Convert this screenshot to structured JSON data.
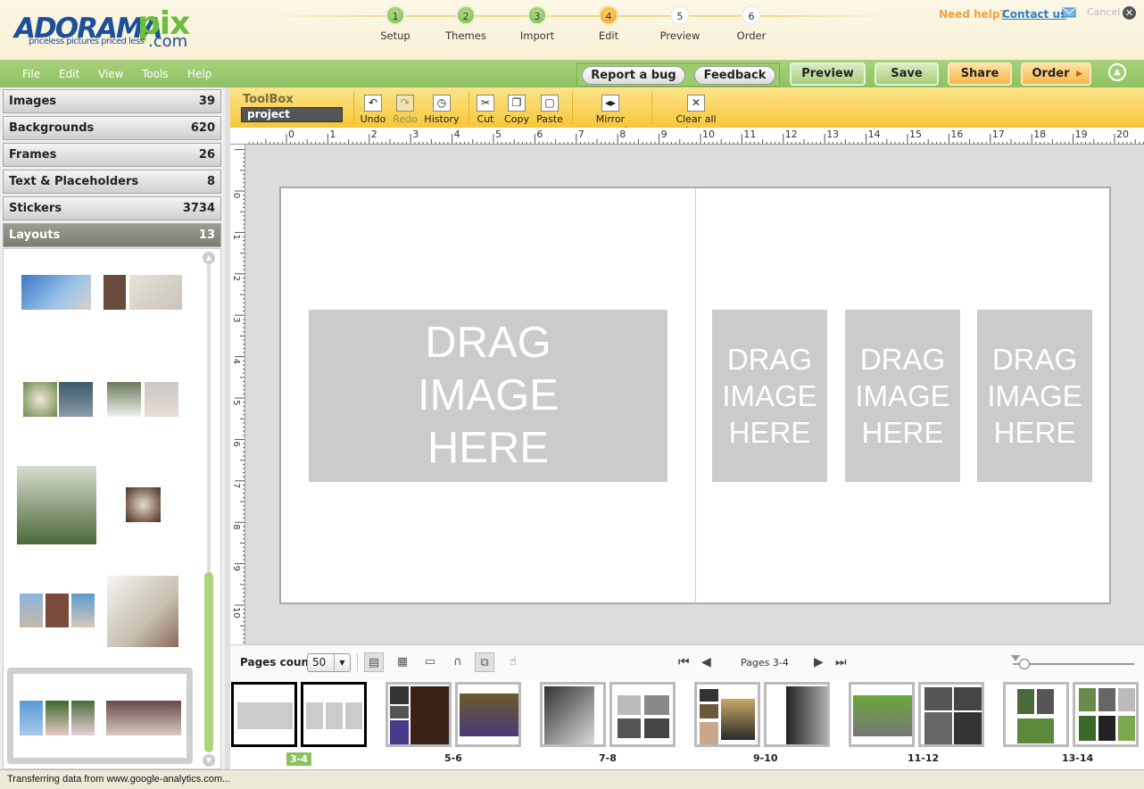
{
  "brand": {
    "name_a": "ADORAMA",
    "name_b": "pix",
    "dotcom": ".com",
    "tagline": "priceless pictures priced less"
  },
  "steps": [
    {
      "num": "1",
      "label": "Setup",
      "state": "done"
    },
    {
      "num": "2",
      "label": "Themes",
      "state": "done"
    },
    {
      "num": "3",
      "label": "Import",
      "state": "done"
    },
    {
      "num": "4",
      "label": "Edit",
      "state": "current"
    },
    {
      "num": "5",
      "label": "Preview",
      "state": "todo"
    },
    {
      "num": "6",
      "label": "Order",
      "state": "todo"
    }
  ],
  "help": {
    "text": "Need help?",
    "contact": "Contact us",
    "cancel": "Cancel"
  },
  "menu": [
    "File",
    "Edit",
    "View",
    "Tools",
    "Help"
  ],
  "actions": {
    "report_bug": "Report a bug",
    "feedback": "Feedback",
    "preview": "Preview",
    "save": "Save",
    "share": "Share",
    "order": "Order"
  },
  "sidebar": {
    "categories": [
      {
        "label": "Images",
        "count": "39"
      },
      {
        "label": "Backgrounds",
        "count": "620"
      },
      {
        "label": "Frames",
        "count": "26"
      },
      {
        "label": "Text & Placeholders",
        "count": "8"
      },
      {
        "label": "Stickers",
        "count": "3734"
      },
      {
        "label": "Layouts",
        "count": "13",
        "active": true
      }
    ]
  },
  "toolbox": {
    "title": "ToolBox",
    "project": "project",
    "tools": [
      {
        "label": "Undo",
        "icon": "undo-icon",
        "glyph": "↶",
        "enabled": true
      },
      {
        "label": "Redo",
        "icon": "redo-icon",
        "glyph": "↷",
        "enabled": false
      },
      {
        "label": "History",
        "icon": "history-icon",
        "glyph": "◷",
        "enabled": true
      },
      {
        "label": "Cut",
        "icon": "cut-icon",
        "glyph": "✂",
        "enabled": true
      },
      {
        "label": "Copy",
        "icon": "copy-icon",
        "glyph": "❐",
        "enabled": true
      },
      {
        "label": "Paste",
        "icon": "paste-icon",
        "glyph": "▢",
        "enabled": true
      },
      {
        "label": "Mirror spread",
        "icon": "mirror-icon",
        "glyph": "◂▸",
        "enabled": true
      },
      {
        "label": "Clear all photos",
        "icon": "clear-photos-icon",
        "glyph": "✕",
        "enabled": true
      }
    ]
  },
  "rulers": {
    "horizontal": [
      "0",
      "1",
      "2",
      "3",
      "4",
      "5",
      "6",
      "7",
      "8",
      "9",
      "10",
      "11",
      "12",
      "13",
      "14",
      "15",
      "16",
      "17",
      "18",
      "19",
      "20"
    ],
    "vertical": [
      "0",
      "1",
      "2",
      "3",
      "4",
      "5",
      "6",
      "7",
      "8",
      "9",
      "10"
    ]
  },
  "canvas": {
    "placeholder_text": "DRAG IMAGE HERE"
  },
  "bottom": {
    "pages_count_label": "Pages count",
    "pages_count_value": "50",
    "pages_label": "Pages 3-4",
    "zoom_level": 0.1
  },
  "pages": [
    {
      "label": "3-4",
      "selected": true
    },
    {
      "label": "5-6"
    },
    {
      "label": "7-8"
    },
    {
      "label": "9-10"
    },
    {
      "label": "11-12"
    },
    {
      "label": "13-14"
    }
  ],
  "status": "Transferring data from www.google-analytics.com...",
  "colors": {
    "green": "#8fc063",
    "orange": "#f7b64a",
    "toolbox": "#f6c738",
    "brand_blue": "#1d4f9a"
  }
}
